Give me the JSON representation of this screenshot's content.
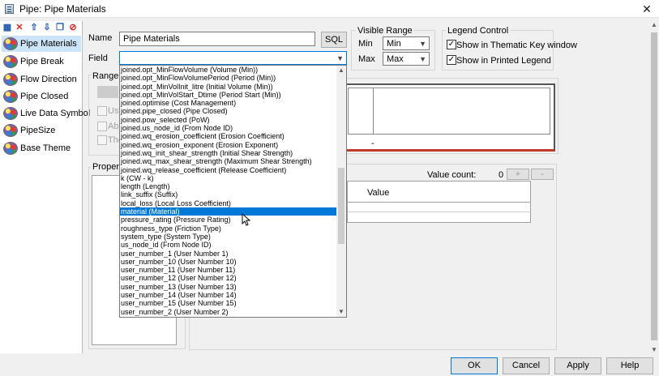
{
  "window": {
    "title": "Pipe: Pipe Materials",
    "close_glyph": "✕"
  },
  "toolbar": {
    "icons": [
      {
        "name": "layers-icon",
        "glyph": "▦",
        "color": "#1e5aa8"
      },
      {
        "name": "delete-icon",
        "glyph": "✕",
        "color": "#d9261c"
      },
      {
        "name": "move-up-icon",
        "glyph": "⇧",
        "color": "#1e5aa8"
      },
      {
        "name": "move-down-icon",
        "glyph": "⇩",
        "color": "#1e5aa8"
      },
      {
        "name": "copy-icon",
        "glyph": "❐",
        "color": "#1e5aa8"
      },
      {
        "name": "no-entry-icon",
        "glyph": "⊘",
        "color": "#d9261c"
      }
    ]
  },
  "sidebar": {
    "items": [
      {
        "label": "Pipe Materials",
        "selected": true
      },
      {
        "label": "Pipe Break",
        "selected": false
      },
      {
        "label": "Flow Direction",
        "selected": false
      },
      {
        "label": "Pipe Closed",
        "selected": false
      },
      {
        "label": "Live Data Symbol",
        "selected": false
      },
      {
        "label": "PipeSize",
        "selected": false
      },
      {
        "label": "Base Theme",
        "selected": false
      }
    ]
  },
  "form": {
    "name_label": "Name",
    "name_value": "Pipe Materials",
    "sql_label": "SQL",
    "field_label": "Field",
    "field_value": "",
    "range_label": "Range",
    "use_label": "Use",
    "abs_label": "Abs",
    "the_label": "The",
    "properties_label": "Properties"
  },
  "visible_range": {
    "title": "Visible Range",
    "min_label": "Min",
    "min_value": "Min",
    "max_label": "Max",
    "max_value": "Max"
  },
  "legend_control": {
    "title": "Legend Control",
    "show_thematic_label": "Show in Thematic Key window",
    "show_thematic_checked": true,
    "show_printed_label": "Show in Printed Legend",
    "show_printed_checked": true
  },
  "legend_preview": {
    "dash": "-"
  },
  "values_panel": {
    "value_count_label": "Value count:",
    "value_count": "0",
    "add_label": "+",
    "remove_label": "-",
    "value_header": "Value"
  },
  "dropdown": {
    "items": [
      "joined.opt_MinFlowVolume (Volume (Min))",
      "joined.opt_MinFlowVolumePeriod (Period (Min))",
      "joined.opt_MinVolInit_litre (Initial Volume (Min))",
      "joined.opt_MinVolStart_Dtime (Period Start (Min))",
      "joined.optimise (Cost Management)",
      "joined.pipe_closed (Pipe Closed)",
      "joined.pow_selected (PoW)",
      "joined.us_node_id (From Node ID)",
      "joined.wq_erosion_coefficient (Erosion Coefficient)",
      "joined.wq_erosion_exponent (Erosion Exponent)",
      "joined.wq_init_shear_strength (Initial Shear Strength)",
      "joined.wq_max_shear_strength (Maximum Shear Strength)",
      "joined.wq_release_coefficient (Release Coefficient)",
      "k (CW - k)",
      "length (Length)",
      "link_suffix (Suffix)",
      "local_loss (Local Loss Coefficient)",
      "material (Material)",
      "pressure_rating (Pressure Rating)",
      "roughness_type (Friction Type)",
      "system_type (System Type)",
      "us_node_id (From Node ID)",
      "user_number_1 (User Number 1)",
      "user_number_10 (User Number 10)",
      "user_number_11 (User Number 11)",
      "user_number_12 (User Number 12)",
      "user_number_13 (User Number 13)",
      "user_number_14 (User Number 14)",
      "user_number_15 (User Number 15)",
      "user_number_2 (User Number 2)"
    ],
    "selected_index": 17
  },
  "footer": {
    "ok": "OK",
    "cancel": "Cancel",
    "apply": "Apply",
    "help": "Help"
  },
  "colors": {
    "selection": "#0078d7",
    "legend_border": "#c0392b"
  }
}
